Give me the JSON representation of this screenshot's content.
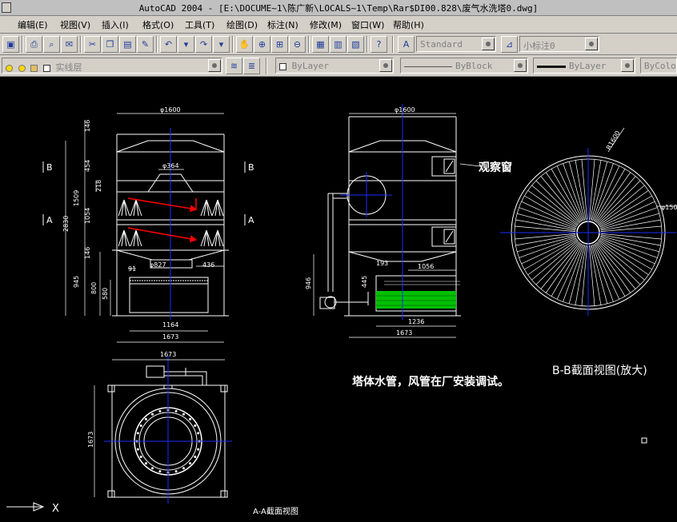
{
  "window": {
    "title": "AutoCAD 2004 - [E:\\DOCUME~1\\陈广新\\LOCALS~1\\Temp\\Rar$DI00.828\\废气水洗塔0.dwg]"
  },
  "menu": {
    "items": [
      "编辑(E)",
      "视图(V)",
      "插入(I)",
      "格式(O)",
      "工具(T)",
      "绘图(D)",
      "标注(N)",
      "修改(M)",
      "窗口(W)",
      "帮助(H)"
    ]
  },
  "toolbar": {
    "text_style": "Standard",
    "dim_style": "小标注0",
    "layer": "实线层",
    "color": "ByLayer",
    "linetype": "ByBlock",
    "lineweight": "ByLayer",
    "plot_style": "ByColor"
  },
  "drawing": {
    "dims": {
      "d1600_left": "φ1600",
      "d1600_right": "φ1600",
      "d364": "φ364",
      "d827": "φ827",
      "r1600": "R1600",
      "d150": "φ150",
      "v146a": "146",
      "v454": "454",
      "v218": "218",
      "v1509": "1509",
      "v1054": "1054",
      "v2830": "2830",
      "v146b": "146",
      "v945": "945",
      "v800": "800",
      "v580": "580",
      "v91": "91",
      "v436": "436",
      "v1164": "1164",
      "v1673a": "1673",
      "v946": "946",
      "v193": "193",
      "v1056": "1056",
      "v445": "445",
      "v1236": "1236",
      "v1673b": "1673",
      "v1673c": "1673",
      "v1673d": "1673"
    },
    "section_labels": {
      "b1": "B",
      "b2": "B",
      "a1": "A",
      "a2": "A"
    },
    "observation_window": "观察窗",
    "note": "塔体水管，风管在厂安装调试。",
    "bb_title": "B-B截面视图(放大)",
    "aa_title": "A-A截面视图",
    "ucs_x": "X"
  }
}
